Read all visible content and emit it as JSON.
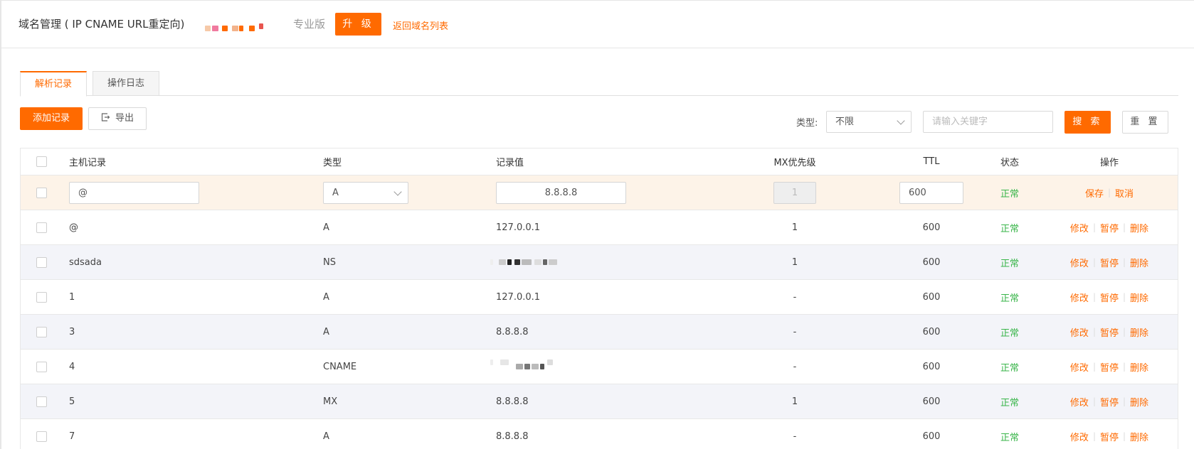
{
  "header": {
    "title": "域名管理 ( IP CNAME URL重定向)",
    "edition": "专业版",
    "upgrade_label": "升 级",
    "back_link": "返回域名列表"
  },
  "tabs": [
    {
      "label": "解析记录",
      "active": true
    },
    {
      "label": "操作日志",
      "active": false
    }
  ],
  "toolbar": {
    "add_label": "添加记录",
    "export_label": "导出",
    "type_label": "类型:",
    "type_value": "不限",
    "keyword_placeholder": "请输入关键字",
    "search_label": "搜 索",
    "reset_label": "重 置"
  },
  "table": {
    "columns": [
      "主机记录",
      "类型",
      "记录值",
      "MX优先级",
      "TTL",
      "状态",
      "操作"
    ],
    "edit_row": {
      "host": "@",
      "type": "A",
      "value": "8.8.8.8",
      "mx": "1",
      "ttl": "600",
      "status": "正常",
      "save": "保存",
      "cancel": "取消"
    },
    "rows": [
      {
        "host": "@",
        "type": "A",
        "value": "127.0.0.1",
        "mx": "1",
        "ttl": "600",
        "status": "正常"
      },
      {
        "host": "sdsada",
        "type": "NS",
        "value": "",
        "mx": "1",
        "ttl": "600",
        "status": "正常"
      },
      {
        "host": "1",
        "type": "A",
        "value": "127.0.0.1",
        "mx": "-",
        "ttl": "600",
        "status": "正常"
      },
      {
        "host": "3",
        "type": "A",
        "value": "8.8.8.8",
        "mx": "-",
        "ttl": "600",
        "status": "正常"
      },
      {
        "host": "4",
        "type": "CNAME",
        "value": "",
        "mx": "-",
        "ttl": "600",
        "status": "正常"
      },
      {
        "host": "5",
        "type": "MX",
        "value": "8.8.8.8",
        "mx": "1",
        "ttl": "600",
        "status": "正常"
      },
      {
        "host": "7",
        "type": "A",
        "value": "8.8.8.8",
        "mx": "-",
        "ttl": "600",
        "status": "正常"
      }
    ],
    "actions": {
      "edit": "修改",
      "pause": "暂停",
      "delete": "删除"
    }
  },
  "colors": {
    "accent": "#ff6a00",
    "status_ok": "#39b54a",
    "edit_row_bg": "#fdf3e8",
    "alt_row_bg": "#f3f4f9"
  }
}
